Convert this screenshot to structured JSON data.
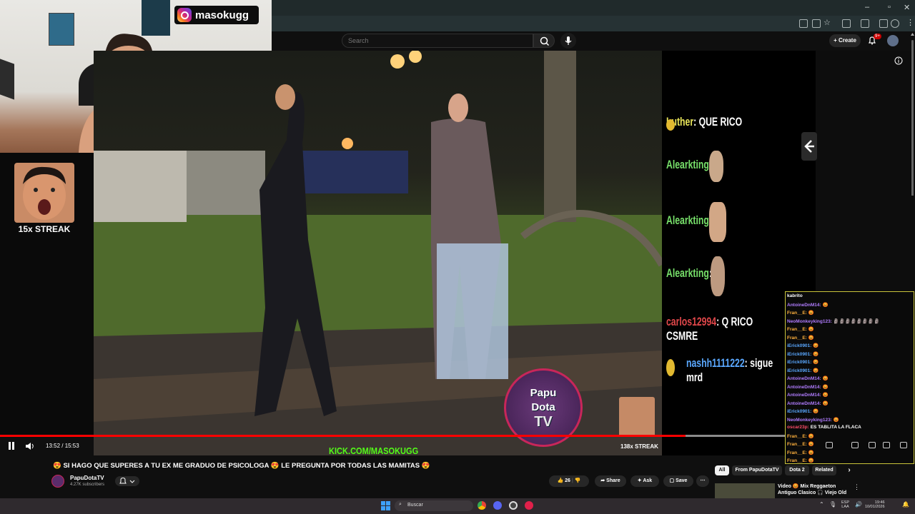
{
  "facecam": {
    "instagram_handle": "masokugg"
  },
  "streak": {
    "label": "15x STREAK"
  },
  "browser": {
    "search_placeholder": "Search",
    "create_label": "Create",
    "notification_badge": "9+"
  },
  "overlay_chat": [
    {
      "user": "Luther",
      "message": "QUE RICO",
      "color": "#e9e65a"
    },
    {
      "user": "Alearkting",
      "message": "",
      "color": "#77e06a"
    },
    {
      "user": "Alearkting",
      "message": "",
      "color": "#77e06a"
    },
    {
      "user": "Alearkting",
      "message": "",
      "color": "#77e06a"
    },
    {
      "user": "carlos12994",
      "message": "Q RICO CSMRE",
      "color": "#e0474a"
    },
    {
      "user": "nashh1111222",
      "message": "sigue mrd",
      "color": "#5aa8ff"
    }
  ],
  "video": {
    "kick_url": "KICK.COM/MASOKUGG",
    "logo_text": [
      "Papu",
      "Dota",
      "TV"
    ],
    "bottom_streak": "138x STREAK",
    "time_display": "13:52 / 15:53",
    "progress": 0.873
  },
  "chat_list": [
    {
      "user": "kabrito",
      "message": "",
      "color": "#ffffff"
    },
    {
      "user": "AntoineDnM14:",
      "message": "😡",
      "color": "#b17cff"
    },
    {
      "user": "Fran__E:",
      "message": "😡",
      "color": "#ffb13d"
    },
    {
      "user": "NeoMonkeyking123:",
      "message": "🗿🗿🗿🗿🗿🗿🗿🗿",
      "color": "#b17cff"
    },
    {
      "user": "Fran__E:",
      "message": "😡",
      "color": "#ffb13d"
    },
    {
      "user": "Fran__E:",
      "message": "😡",
      "color": "#ffb13d"
    },
    {
      "user": "iErick0901:",
      "message": "😡",
      "color": "#5aa8ff"
    },
    {
      "user": "iErick0901:",
      "message": "😡",
      "color": "#5aa8ff"
    },
    {
      "user": "iErick0901:",
      "message": "😡",
      "color": "#5aa8ff"
    },
    {
      "user": "iErick0901:",
      "message": "😡",
      "color": "#5aa8ff"
    },
    {
      "user": "AntoineDnM14:",
      "message": "😡",
      "color": "#b17cff"
    },
    {
      "user": "AntoineDnM14:",
      "message": "😡",
      "color": "#b17cff"
    },
    {
      "user": "AntoineDnM14:",
      "message": "😡",
      "color": "#b17cff"
    },
    {
      "user": "AntoineDnM14:",
      "message": "😡",
      "color": "#b17cff"
    },
    {
      "user": "iErick0901:",
      "message": "😡",
      "color": "#5aa8ff"
    },
    {
      "user": "NeoMonkeyking123:",
      "message": "😡",
      "color": "#b17cff"
    },
    {
      "user": "oscar23p:",
      "message": "ES TABLITA LA FLACA",
      "color": "#ff4d6a"
    },
    {
      "user": "Fran__E:",
      "message": "😡",
      "color": "#ffb13d"
    },
    {
      "user": "Fran__E:",
      "message": "😡",
      "color": "#ffb13d"
    },
    {
      "user": "Fran__E:",
      "message": "😡",
      "color": "#ffb13d"
    },
    {
      "user": "Fran__E:",
      "message": "😡",
      "color": "#ffb13d"
    }
  ],
  "video_info": {
    "title": "😍 SI HAGO QUE SUPERES A TU EX ME GRADUO DE PSICOLOGA 😍 LE PREGUNTA POR TODAS LAS MAMITAS 😍",
    "channel_name": "PapuDotaTV",
    "subscribers": "4.27K subscribers",
    "like_count": "26",
    "share_label": "Share",
    "ask_label": "Ask",
    "save_label": "Save"
  },
  "chips": [
    "All",
    "From PapuDotaTV",
    "Dota 2",
    "Related"
  ],
  "recommended": {
    "title": "Video 😡 Mix Reggaeton Antiguo Clasico 🎧 Viejo Old ..."
  },
  "taskbar": {
    "search_placeholder": "Buscar",
    "lang_line1": "ESP",
    "lang_line2": "LAA",
    "time": "19:46",
    "date": "10/01/2026"
  }
}
